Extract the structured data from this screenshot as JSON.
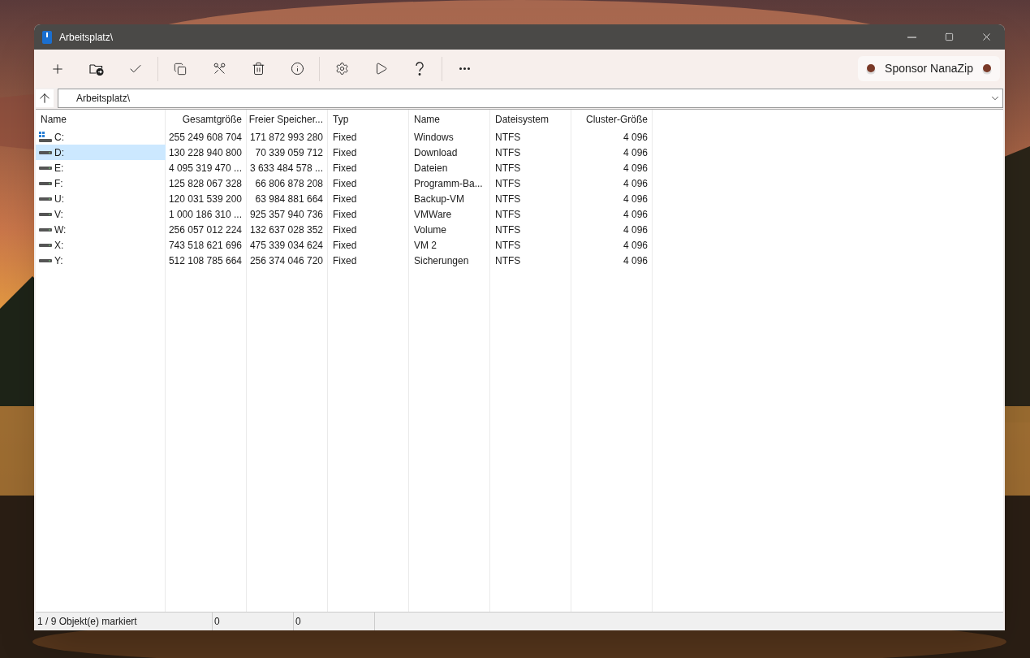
{
  "window": {
    "title": "Arbeitsplatz\\"
  },
  "sponsor_button": {
    "label": "Sponsor NanaZip"
  },
  "address_bar": {
    "value": "Arbeitsplatz\\"
  },
  "table": {
    "columns": [
      {
        "label": "Name"
      },
      {
        "label": "Gesamtgröße"
      },
      {
        "label": "Freier Speicher..."
      },
      {
        "label": "Typ"
      },
      {
        "label": "Name"
      },
      {
        "label": "Dateisystem"
      },
      {
        "label": "Cluster-Größe"
      }
    ],
    "rows": [
      {
        "kind": "system",
        "selected": false,
        "cells": [
          "C:",
          "255 249 608 704",
          "171 872 993 280",
          "Fixed",
          "Windows",
          "NTFS",
          "4 096"
        ]
      },
      {
        "kind": "disk",
        "selected": true,
        "cells": [
          "D:",
          "130 228 940 800",
          "70 339 059 712",
          "Fixed",
          "Download",
          "NTFS",
          "4 096"
        ]
      },
      {
        "kind": "disk",
        "selected": false,
        "cells": [
          "E:",
          "4 095 319 470 ...",
          "3 633 484 578 ...",
          "Fixed",
          "Dateien",
          "NTFS",
          "4 096"
        ]
      },
      {
        "kind": "disk",
        "selected": false,
        "cells": [
          "F:",
          "125 828 067 328",
          "66 806 878 208",
          "Fixed",
          "Programm-Ba...",
          "NTFS",
          "4 096"
        ]
      },
      {
        "kind": "disk",
        "selected": false,
        "cells": [
          "U:",
          "120 031 539 200",
          "63 984 881 664",
          "Fixed",
          "Backup-VM",
          "NTFS",
          "4 096"
        ]
      },
      {
        "kind": "disk",
        "selected": false,
        "cells": [
          "V:",
          "1 000 186 310 ...",
          "925 357 940 736",
          "Fixed",
          "VMWare",
          "NTFS",
          "4 096"
        ]
      },
      {
        "kind": "disk",
        "selected": false,
        "cells": [
          "W:",
          "256 057 012 224",
          "132 637 028 352",
          "Fixed",
          "Volume",
          "NTFS",
          "4 096"
        ]
      },
      {
        "kind": "disk",
        "selected": false,
        "cells": [
          "X:",
          "743 518 621 696",
          "475 339 034 624",
          "Fixed",
          "VM 2",
          "NTFS",
          "4 096"
        ]
      },
      {
        "kind": "disk",
        "selected": false,
        "cells": [
          "Y:",
          "512 108 785 664",
          "256 374 046 720",
          "Fixed",
          "Sicherungen",
          "NTFS",
          "4 096"
        ]
      }
    ]
  },
  "status_bar": [
    "1 / 9 Objekt(e) markiert",
    "0",
    "0"
  ]
}
